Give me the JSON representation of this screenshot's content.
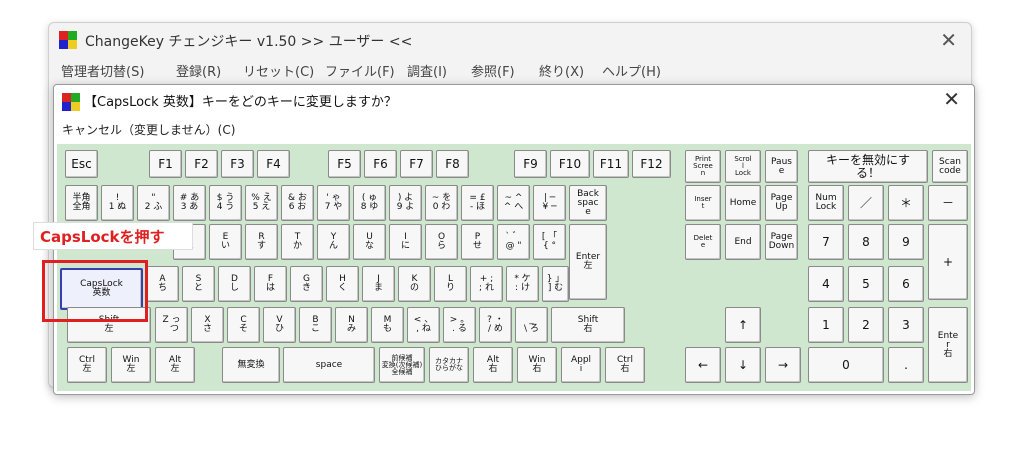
{
  "window": {
    "title": "ChangeKey チェンジキー v1.50   >> ユーザー <<",
    "close_glyph": "✕",
    "menu": [
      "管理者切替(S)",
      "登録(R)",
      "リセット(C)",
      "ファイル(F)",
      "調査(I)",
      "参照(F)",
      "終り(X)",
      "ヘルプ(H)"
    ]
  },
  "dialog": {
    "title": "【CapsLock 英数】キーをどのキーに変更しますか？",
    "close_glyph": "✕",
    "cancel_label": "キャンセル（変更しません）(C)"
  },
  "annotation": {
    "text": "CapsLockを押す",
    "color": "#e02020"
  },
  "colors": {
    "keyboard_bg": "#cfe7cf",
    "selected_border": "#3a3fb0",
    "highlight": "#e02020"
  },
  "keys": [
    {
      "label": "Esc"
    },
    {
      "label": "F1"
    },
    {
      "label": "F2"
    },
    {
      "label": "F3"
    },
    {
      "label": "F4"
    },
    {
      "label": "F5"
    },
    {
      "label": "F6"
    },
    {
      "label": "F7"
    },
    {
      "label": "F8"
    },
    {
      "label": "F9"
    },
    {
      "label": "F10"
    },
    {
      "label": "F11"
    },
    {
      "label": "F12"
    },
    {
      "label": "Print\nScree\nn"
    },
    {
      "label": "Scrol\nl\nLock"
    },
    {
      "label": "Paus\ne"
    },
    {
      "label": "キーを無効にす\nる！"
    },
    {
      "label": "Scan\ncode"
    },
    {
      "label": "半角\n全角"
    },
    {
      "label": "!\n1 ぬ"
    },
    {
      "label": "\"\n2 ふ"
    },
    {
      "label": "# あ\n3 あ"
    },
    {
      "label": "$ う\n4 う"
    },
    {
      "label": "% え\n5 え"
    },
    {
      "label": "& お\n6 お"
    },
    {
      "label": "' ゃ\n7 や"
    },
    {
      "label": "( ゅ\n8 ゆ"
    },
    {
      "label": ") よ\n9 よ"
    },
    {
      "label": "~ を\n0 わ"
    },
    {
      "label": "= £\n- ほ"
    },
    {
      "label": "~ ^\n^ へ"
    },
    {
      "label": "| ─\n¥ ─"
    },
    {
      "label": "Back\nspac\ne"
    },
    {
      "label": "Inser\nt"
    },
    {
      "label": "Home"
    },
    {
      "label": "Page\nUp"
    },
    {
      "label": "Num\nLock"
    },
    {
      "label": "／"
    },
    {
      "label": "＊"
    },
    {
      "label": "－"
    },
    {
      "label": "q\nた"
    },
    {
      "label": "E\nい"
    },
    {
      "label": "R\nす"
    },
    {
      "label": "T\nか"
    },
    {
      "label": "Y\nん"
    },
    {
      "label": "U\nな"
    },
    {
      "label": "I\nに"
    },
    {
      "label": "O\nら"
    },
    {
      "label": "P\nせ"
    },
    {
      "label": "` ゛\n@ \""
    },
    {
      "label": "[ 「\n{ °"
    },
    {
      "label": "Enter\n左"
    },
    {
      "label": "Delet\ne"
    },
    {
      "label": "End"
    },
    {
      "label": "Page\nDown"
    },
    {
      "label": "7"
    },
    {
      "label": "8"
    },
    {
      "label": "9"
    },
    {
      "label": "+"
    },
    {
      "label": "CapsLock\n英数"
    },
    {
      "label": "A\nち"
    },
    {
      "label": "S\nと"
    },
    {
      "label": "D\nし"
    },
    {
      "label": "F\nは"
    },
    {
      "label": "G\nき"
    },
    {
      "label": "H\nく"
    },
    {
      "label": "J\nま"
    },
    {
      "label": "K\nの"
    },
    {
      "label": "L\nり"
    },
    {
      "label": "+ ;\n; れ"
    },
    {
      "label": "* ケ\n: け"
    },
    {
      "label": "} 」\n] む"
    },
    {
      "label": "4"
    },
    {
      "label": "5"
    },
    {
      "label": "6"
    },
    {
      "label": "Shift\n左"
    },
    {
      "label": "Z っ\n  つ"
    },
    {
      "label": "X\nさ"
    },
    {
      "label": "C\nそ"
    },
    {
      "label": "V\nひ"
    },
    {
      "label": "B\nこ"
    },
    {
      "label": "N\nみ"
    },
    {
      "label": "M\nも"
    },
    {
      "label": "< 、\n, ね"
    },
    {
      "label": "> 。\n. る"
    },
    {
      "label": "? ・\n/ め"
    },
    {
      "label": "_\n\\ ろ"
    },
    {
      "label": "Shift\n右"
    },
    {
      "label": "↑"
    },
    {
      "label": "1"
    },
    {
      "label": "2"
    },
    {
      "label": "3"
    },
    {
      "label": "Ente\nr\n右"
    },
    {
      "label": "Ctrl\n左"
    },
    {
      "label": "Win\n左"
    },
    {
      "label": "Alt\n左"
    },
    {
      "label": "無変換"
    },
    {
      "label": "space"
    },
    {
      "label": "前候補\n変換(次候補)\n全候補"
    },
    {
      "label": "カタカナ\nひらがな"
    },
    {
      "label": "Alt\n右"
    },
    {
      "label": "Win\n右"
    },
    {
      "label": "Appl\ni"
    },
    {
      "label": "Ctrl\n右"
    },
    {
      "label": "←"
    },
    {
      "label": "↓"
    },
    {
      "label": "→"
    },
    {
      "label": "0"
    },
    {
      "label": "."
    }
  ]
}
